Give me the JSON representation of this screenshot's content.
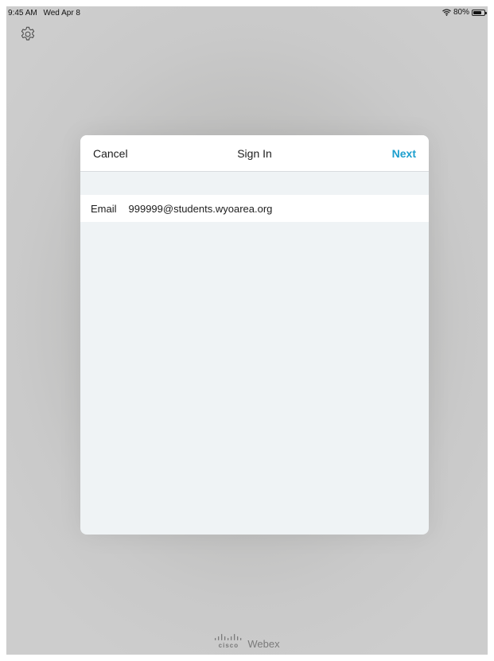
{
  "status_bar": {
    "time": "9:45 AM",
    "date": "Wed Apr 8",
    "battery_percent": "80%",
    "battery_level": 0.8,
    "wifi_icon": "wifi-icon",
    "battery_icon": "battery-icon"
  },
  "settings": {
    "icon": "gear-icon"
  },
  "dialog": {
    "cancel_label": "Cancel",
    "title": "Sign In",
    "next_label": "Next",
    "email_label": "Email",
    "email_value": "999999@students.wyoarea.org"
  },
  "branding": {
    "logo_text": "cisco",
    "product_name": "Webex"
  },
  "colors": {
    "accent": "#1c9fce",
    "dialog_background": "#eff3f5",
    "backdrop": "#c9c9c9"
  }
}
